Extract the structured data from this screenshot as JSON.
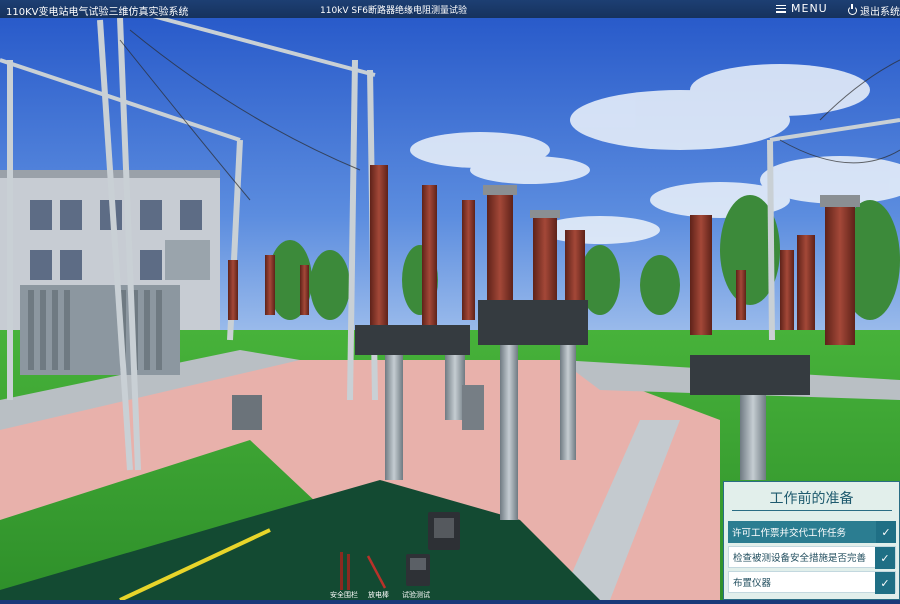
{
  "header": {
    "app_title": "110KV变电站电气试验三维仿真实验系统",
    "scene_title": "110kV SF6断路器绝缘电阻测量试验",
    "menu_label": "MENU",
    "exit_label": "退出系统"
  },
  "task_panel": {
    "title": "工作前的准备",
    "tasks": [
      {
        "label": "许可工作票并交代工作任务",
        "state": "active"
      },
      {
        "label": "检查被测设备安全措施是否完善",
        "state": "inactive"
      },
      {
        "label": "布置仪器",
        "state": "inactive"
      }
    ]
  },
  "toolbar": {
    "tools": [
      {
        "label": "安全围栏"
      },
      {
        "label": "放电棒"
      },
      {
        "label": "试验测试"
      }
    ]
  },
  "colors": {
    "sky": "#3a6fd0",
    "grass": "#3fae36",
    "pavement": "#e6a9a6",
    "insulator": "#8c3a30",
    "panel_accent": "#2b7d91"
  }
}
